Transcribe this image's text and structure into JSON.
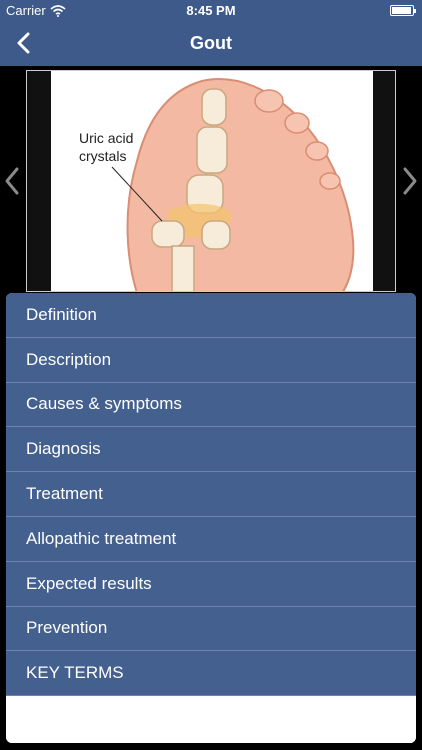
{
  "status_bar": {
    "carrier": "Carrier",
    "time": "8:45 PM"
  },
  "nav": {
    "title": "Gout",
    "back_icon": "chevron-left-icon"
  },
  "illustration": {
    "label": "Uric acid\ncrystals"
  },
  "pager": {
    "prev_icon": "chevron-left-icon",
    "next_icon": "chevron-right-icon"
  },
  "menu": {
    "items": [
      {
        "label": "Definition"
      },
      {
        "label": "Description"
      },
      {
        "label": "Causes & symptoms"
      },
      {
        "label": "Diagnosis"
      },
      {
        "label": "Treatment"
      },
      {
        "label": "Allopathic treatment"
      },
      {
        "label": "Expected results"
      },
      {
        "label": "Prevention"
      },
      {
        "label": "KEY TERMS"
      }
    ]
  },
  "colors": {
    "bar": "#3e5a8a",
    "menu_item": "#44608f",
    "divider": "#6c85b0"
  }
}
